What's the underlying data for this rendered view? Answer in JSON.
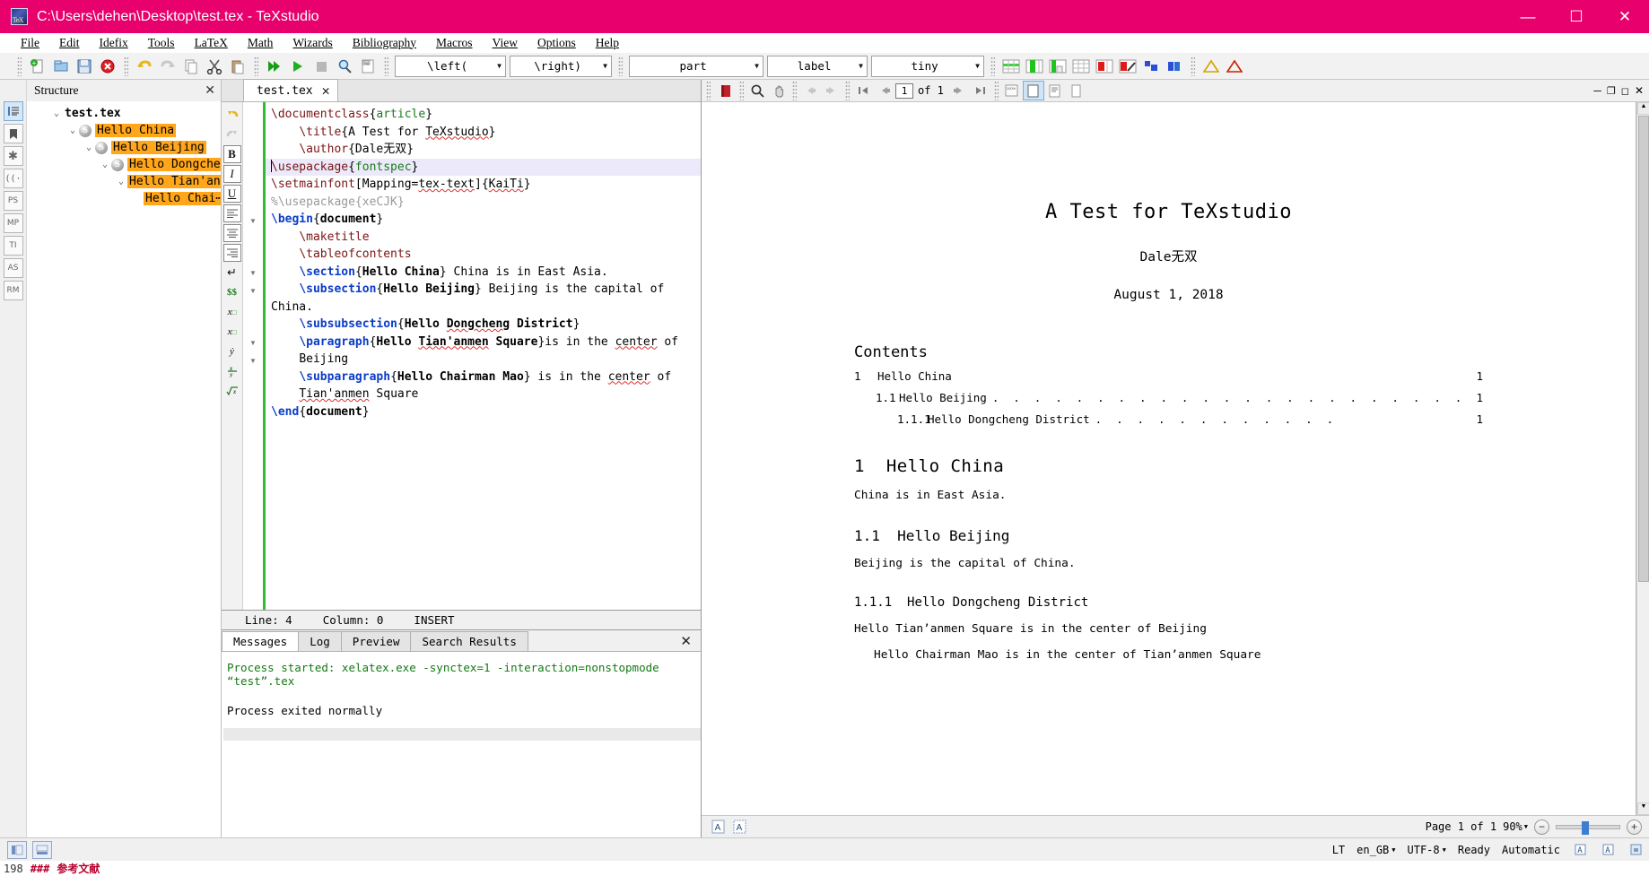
{
  "window": {
    "title": "C:\\Users\\dehen\\Desktop\\test.tex - TeXstudio",
    "minimize": "—",
    "maximize": "☐",
    "close": "✕",
    "accent_color": "#e8006d"
  },
  "menubar": {
    "items": [
      {
        "label": "File"
      },
      {
        "label": "Edit"
      },
      {
        "label": "Idefix"
      },
      {
        "label": "Tools"
      },
      {
        "label": "LaTeX"
      },
      {
        "label": "Math"
      },
      {
        "label": "Wizards"
      },
      {
        "label": "Bibliography"
      },
      {
        "label": "Macros"
      },
      {
        "label": "View"
      },
      {
        "label": "Options"
      },
      {
        "label": "Help"
      }
    ]
  },
  "toolbar": {
    "dropdowns": [
      {
        "name": "left-delimiter",
        "value": "\\left("
      },
      {
        "name": "right-delimiter",
        "value": "\\right)"
      },
      {
        "name": "sectioning-level",
        "value": "part"
      },
      {
        "name": "reference-type",
        "value": "label"
      },
      {
        "name": "font-size",
        "value": "tiny"
      }
    ],
    "icons": [
      "new-file-icon",
      "open-file-icon",
      "save-icon",
      "close-file-icon",
      "undo-icon",
      "redo-icon",
      "copy-icon",
      "cut-icon",
      "paste-icon",
      "build-and-view-icon",
      "compile-icon",
      "stop-icon",
      "view-pdf-icon",
      "view-log-icon",
      "table-icon",
      "table-insert-column-icon",
      "table-add-column-icon",
      "table-row-icon",
      "table-delete-row-icon",
      "table-edit-icon",
      "table-align-icon",
      "table-block-icon",
      "warning-icon",
      "error-icon"
    ]
  },
  "rail": {
    "items": [
      {
        "name": "structure-view",
        "glyph": "☰",
        "selected": true
      },
      {
        "name": "bookmarks-view",
        "glyph": "⚑",
        "selected": false
      },
      {
        "name": "symbols-favorites",
        "glyph": "✱",
        "selected": false
      },
      {
        "name": "symbols-delimiters",
        "glyph": "((·",
        "selected": false
      },
      {
        "name": "postscript-symbols",
        "glyph": "PS",
        "selected": false
      },
      {
        "name": "metapost-symbols",
        "glyph": "MP",
        "selected": false
      },
      {
        "name": "tikz-symbols",
        "glyph": "TI",
        "selected": false
      },
      {
        "name": "asymptote-symbols",
        "glyph": "AS",
        "selected": false
      },
      {
        "name": "recent-symbols",
        "glyph": "RM",
        "selected": false
      }
    ]
  },
  "structure": {
    "title": "Structure",
    "close_glyph": "✕",
    "tree": [
      {
        "label": "test.tex",
        "level": 0,
        "chevron": "⌄",
        "icon": false,
        "highlight": false,
        "root": true
      },
      {
        "label": "Hello China",
        "level": 1,
        "chevron": "⌄",
        "icon": true,
        "highlight": true
      },
      {
        "label": "Hello Beijing",
        "level": 2,
        "chevron": "⌄",
        "icon": true,
        "highlight": true
      },
      {
        "label": "Hello Dongche⋯",
        "level": 3,
        "chevron": "⌄",
        "icon": true,
        "highlight": true
      },
      {
        "label": "Hello Tian'an⋯",
        "level": 4,
        "chevron": "⌄",
        "icon": false,
        "highlight": true
      },
      {
        "label": "Hello Chai⋯",
        "level": 5,
        "chevron": "",
        "icon": false,
        "highlight": true
      }
    ]
  },
  "editor": {
    "tab": {
      "label": "test.tex",
      "close_glyph": "✕"
    },
    "format_buttons": [
      {
        "name": "bold-button",
        "glyph": "B"
      },
      {
        "name": "italic-button",
        "glyph": "I"
      },
      {
        "name": "underline-button",
        "glyph": "U"
      },
      {
        "name": "align-left-button",
        "glyph": "≡"
      },
      {
        "name": "align-center-button",
        "glyph": "≡"
      },
      {
        "name": "align-right-button",
        "glyph": "≡"
      },
      {
        "name": "newline-button",
        "glyph": "↵"
      },
      {
        "name": "math-display-button",
        "glyph": "$$"
      },
      {
        "name": "subscript-button",
        "glyph": "x□"
      },
      {
        "name": "superscript-button",
        "glyph": "x□"
      },
      {
        "name": "dot-accent-button",
        "glyph": "ẏ"
      },
      {
        "name": "fraction-button",
        "glyph": "x/y"
      },
      {
        "name": "sqrt-button",
        "glyph": "√x"
      }
    ],
    "status": {
      "line": "Line: 4",
      "column": "Column: 0",
      "mode": "INSERT"
    },
    "code_lines": [
      {
        "indent": 0,
        "active": false,
        "tokens": [
          {
            "t": "\\documentclass",
            "c": "k-cmd2"
          },
          {
            "t": "{",
            "c": "k-pln"
          },
          {
            "t": "article",
            "c": "k-arg"
          },
          {
            "t": "}",
            "c": "k-pln"
          }
        ]
      },
      {
        "indent": 1,
        "active": false,
        "tokens": [
          {
            "t": "\\title",
            "c": "k-cmd2"
          },
          {
            "t": "{A Test for ",
            "c": "k-pln"
          },
          {
            "t": "TeXstudio",
            "c": "k-pln sq"
          },
          {
            "t": "}",
            "c": "k-pln"
          }
        ]
      },
      {
        "indent": 1,
        "active": false,
        "tokens": [
          {
            "t": "\\author",
            "c": "k-cmd2"
          },
          {
            "t": "{Dale无双}",
            "c": "k-pln"
          }
        ]
      },
      {
        "indent": 0,
        "active": true,
        "tokens": [
          {
            "t": "\\usepackage",
            "c": "k-cmd2"
          },
          {
            "t": "{",
            "c": "k-pln"
          },
          {
            "t": "fontspec",
            "c": "k-arg"
          },
          {
            "t": "}",
            "c": "k-pln"
          }
        ]
      },
      {
        "indent": 0,
        "active": false,
        "tokens": [
          {
            "t": "\\setmainfont",
            "c": "k-cmd2"
          },
          {
            "t": "[Mapping=",
            "c": "k-pln"
          },
          {
            "t": "tex-text",
            "c": "k-pln sq"
          },
          {
            "t": "]{",
            "c": "k-pln"
          },
          {
            "t": "KaiTi",
            "c": "k-pln sq"
          },
          {
            "t": "}",
            "c": "k-pln"
          }
        ]
      },
      {
        "indent": 0,
        "active": false,
        "tokens": [
          {
            "t": "%\\usepackage{xeCJK}",
            "c": "k-cmt"
          }
        ]
      },
      {
        "indent": 0,
        "active": false,
        "tokens": [
          {
            "t": "\\begin",
            "c": "k-cmd"
          },
          {
            "t": "{",
            "c": "k-pln"
          },
          {
            "t": "document",
            "c": "k-argb"
          },
          {
            "t": "}",
            "c": "k-pln"
          }
        ]
      },
      {
        "indent": 1,
        "active": false,
        "tokens": [
          {
            "t": "\\maketitle",
            "c": "k-cmd2"
          }
        ]
      },
      {
        "indent": 1,
        "active": false,
        "tokens": [
          {
            "t": "\\tableofcontents",
            "c": "k-cmd2"
          }
        ]
      },
      {
        "indent": 1,
        "active": false,
        "tokens": [
          {
            "t": "\\section",
            "c": "k-cmd"
          },
          {
            "t": "{",
            "c": "k-pln"
          },
          {
            "t": "Hello China",
            "c": "k-argb"
          },
          {
            "t": "} China is in East Asia.",
            "c": "k-pln"
          }
        ]
      },
      {
        "indent": 1,
        "active": false,
        "tokens": [
          {
            "t": "\\subsection",
            "c": "k-cmd"
          },
          {
            "t": "{",
            "c": "k-pln"
          },
          {
            "t": "Hello Beijing",
            "c": "k-argb"
          },
          {
            "t": "} Beijing is the capital of",
            "c": "k-pln"
          }
        ]
      },
      {
        "indent": 0,
        "active": false,
        "tokens": [
          {
            "t": "China.",
            "c": "k-pln"
          }
        ]
      },
      {
        "indent": 1,
        "active": false,
        "tokens": [
          {
            "t": "\\subsubsection",
            "c": "k-cmd"
          },
          {
            "t": "{",
            "c": "k-pln"
          },
          {
            "t": "Hello ",
            "c": "k-argb"
          },
          {
            "t": "Dongcheng",
            "c": "k-argb sq"
          },
          {
            "t": " District",
            "c": "k-argb"
          },
          {
            "t": "}",
            "c": "k-pln"
          }
        ]
      },
      {
        "indent": 1,
        "active": false,
        "tokens": [
          {
            "t": "\\paragraph",
            "c": "k-cmd"
          },
          {
            "t": "{",
            "c": "k-pln"
          },
          {
            "t": "Hello ",
            "c": "k-argb"
          },
          {
            "t": "Tian'anmen",
            "c": "k-argb sq"
          },
          {
            "t": " Square",
            "c": "k-argb"
          },
          {
            "t": "}is in the ",
            "c": "k-pln"
          },
          {
            "t": "center",
            "c": "k-pln sq"
          },
          {
            "t": " of",
            "c": "k-pln"
          }
        ]
      },
      {
        "indent": 1,
        "active": false,
        "tokens": [
          {
            "t": "Beijing",
            "c": "k-pln"
          }
        ]
      },
      {
        "indent": 1,
        "active": false,
        "tokens": [
          {
            "t": "\\subparagraph",
            "c": "k-cmd"
          },
          {
            "t": "{",
            "c": "k-pln"
          },
          {
            "t": "Hello Chairman Mao",
            "c": "k-argb"
          },
          {
            "t": "} is in the ",
            "c": "k-pln"
          },
          {
            "t": "center",
            "c": "k-pln sq"
          },
          {
            "t": " of",
            "c": "k-pln"
          }
        ]
      },
      {
        "indent": 1,
        "active": false,
        "tokens": [
          {
            "t": "Tian'anmen",
            "c": "k-pln sq"
          },
          {
            "t": " Square",
            "c": "k-pln"
          }
        ]
      },
      {
        "indent": 0,
        "active": false,
        "tokens": [
          {
            "t": "\\end",
            "c": "k-cmd"
          },
          {
            "t": "{",
            "c": "k-pln"
          },
          {
            "t": "document",
            "c": "k-argb"
          },
          {
            "t": "}",
            "c": "k-pln"
          }
        ]
      }
    ]
  },
  "messages": {
    "tabs": [
      {
        "label": "Messages",
        "selected": true
      },
      {
        "label": "Log",
        "selected": false
      },
      {
        "label": "Preview",
        "selected": false
      },
      {
        "label": "Search Results",
        "selected": false
      }
    ],
    "close_glyph": "✕",
    "lines": [
      {
        "text": "Process started: xelatex.exe -synctex=1 -interaction=nonstopmode “test”.tex",
        "green": true
      },
      {
        "text": "",
        "green": false
      },
      {
        "text": "Process exited normally",
        "green": false
      }
    ]
  },
  "pdf": {
    "toolbar": {
      "icons": [
        "pdf-document-icon",
        "magnify-icon",
        "hand-tool-icon",
        "back-icon",
        "forward-icon",
        "first-page-icon",
        "previous-page-icon",
        "next-page-icon",
        "last-page-icon",
        "fit-zoom-icon",
        "fit-width-icon",
        "fit-text-width-icon",
        "fit-page-icon"
      ],
      "page_value": "1",
      "page_of": "of  1"
    },
    "window_buttons": [
      "minimize-pdf",
      "restore-pdf",
      "maximize-pdf",
      "close-pdf"
    ],
    "document": {
      "title": "A Test for TeXstudio",
      "author": "Dale无双",
      "date": "August 1, 2018",
      "contents_heading": "Contents",
      "toc": [
        {
          "number": "1",
          "text": "Hello China",
          "page": "1",
          "level": 1,
          "dots": false
        },
        {
          "number": "1.1",
          "text": "Hello Beijing",
          "page": "1",
          "level": 2,
          "dots": true
        },
        {
          "number": "1.1.1",
          "text": "Hello Dongcheng District",
          "page": "1",
          "level": 3,
          "dots": true
        }
      ],
      "sections": [
        {
          "kind": "h1",
          "number": "1",
          "text": "Hello China"
        },
        {
          "kind": "p",
          "text": "China is in East Asia."
        },
        {
          "kind": "h2",
          "number": "1.1",
          "text": "Hello Beijing"
        },
        {
          "kind": "p",
          "text": "Beijing is the capital of China."
        },
        {
          "kind": "h3",
          "number": "1.1.1",
          "text": "Hello Dongcheng District"
        },
        {
          "kind": "p",
          "text": "Hello Tian’anmen Square  is in the center of Beijing"
        },
        {
          "kind": "p-indent",
          "text": "Hello Chairman Mao  is in the center of Tian’anmen Square"
        }
      ]
    },
    "bottom": {
      "page_label": "Page 1 of 1",
      "zoom": "90%",
      "zoom_out": "−",
      "zoom_in": "+",
      "left_icons": [
        "text-tool-icon",
        "select-tool-icon"
      ]
    }
  },
  "statusbar": {
    "left_icons": [
      "toggle-structure-icon",
      "toggle-messages-icon"
    ],
    "right": {
      "lt_label": "LT",
      "language": "en_GB",
      "encoding": "UTF-8",
      "ready": "Ready",
      "mode": "Automatic",
      "icons": [
        "spellcheck-icon",
        "syntaxcheck-icon",
        "session-icon"
      ]
    }
  },
  "background_page": {
    "hashes": "###",
    "heading": "参考文献",
    "line_number": "198"
  }
}
